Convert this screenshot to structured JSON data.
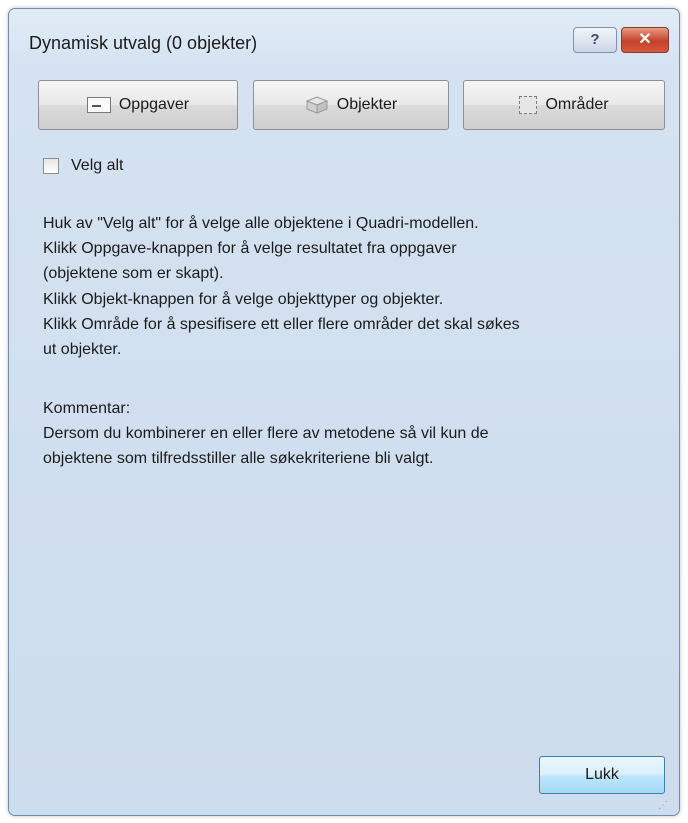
{
  "window": {
    "title": "Dynamisk utvalg (0 objekter)"
  },
  "title_bar": {
    "help_glyph": "?",
    "close_glyph": "✕"
  },
  "buttons": {
    "tasks": {
      "label": "Oppgaver",
      "icon": "task-icon"
    },
    "objects": {
      "label": "Objekter",
      "icon": "object-cube-icon"
    },
    "areas": {
      "label": "Områder",
      "icon": "area-icon"
    }
  },
  "select_all": {
    "label": "Velg alt",
    "checked": false
  },
  "help_lines": [
    "Huk av \"Velg alt\" for å velge alle objektene i Quadri-modellen.",
    "Klikk Oppgave-knappen for å velge resultatet fra oppgaver",
    "(objektene som er skapt).",
    "Klikk Objekt-knappen for å velge objekttyper og objekter.",
    "Klikk Område for å spesifisere ett eller flere områder det skal søkes",
    "ut objekter."
  ],
  "comment": {
    "heading": "Kommentar:",
    "lines": [
      "Dersom du kombinerer en eller flere av metodene så vil kun de",
      "objektene som tilfredsstiller alle søkekriteriene bli valgt."
    ]
  },
  "close_button": {
    "label": "Lukk"
  }
}
